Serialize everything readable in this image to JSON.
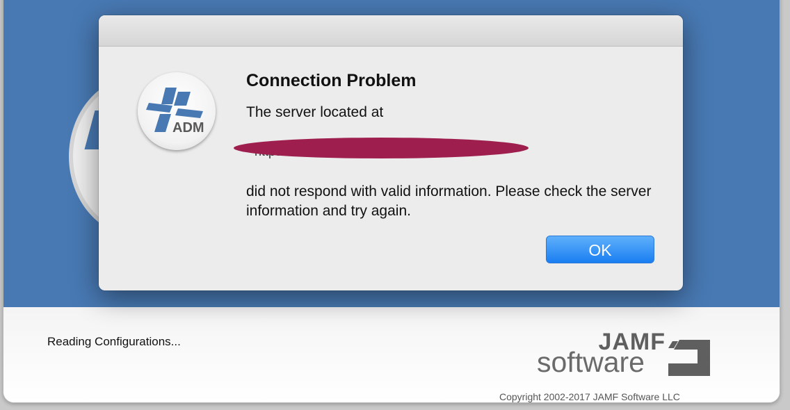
{
  "background_window": {
    "status_text": "Reading Configurations...",
    "brand": {
      "name_top": "JAMF",
      "name_bottom": "software"
    },
    "copyright": "Copyright 2002-2017 JAMF Software LLC"
  },
  "dialog": {
    "icon_label": "ADM",
    "title": "Connection Problem",
    "line1": "The server located at",
    "server_url": "https://",
    "message": "did not respond with valid information. Please check the server information and try again.",
    "ok_label": "OK"
  },
  "colors": {
    "accent_blue": "#4879b3",
    "button_blue": "#1a7ef1",
    "redaction": "#9e1f4e"
  },
  "icons": {
    "app": "adm-logo-icon",
    "brand_mark": "jamf-logo-icon"
  }
}
